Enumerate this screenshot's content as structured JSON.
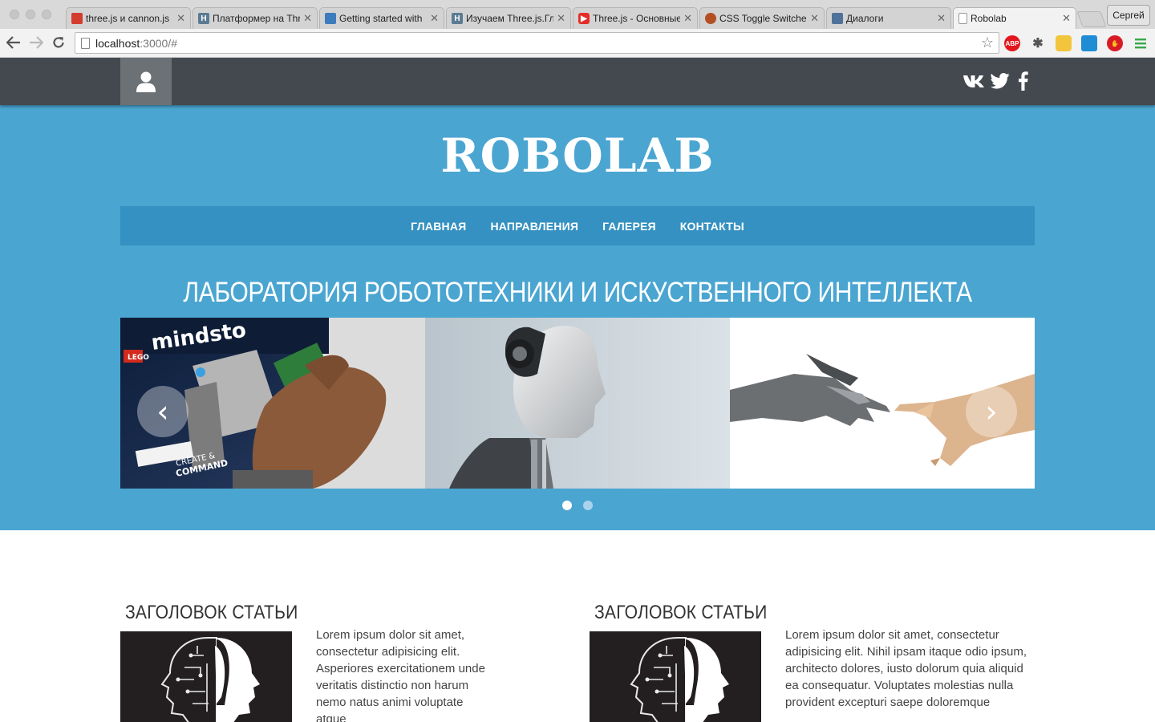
{
  "browser": {
    "tabs": [
      {
        "title": "three.js и cannon.js",
        "favicon_color": "#d43b2f"
      },
      {
        "title": "Платформер на Three",
        "favicon_color": "#5b7b93"
      },
      {
        "title": "Getting started with",
        "favicon_color": "#3e7bbd"
      },
      {
        "title": "Изучаем Three.js.Гл",
        "favicon_color": "#5b7b93"
      },
      {
        "title": "Three.js - Основные",
        "favicon_color": "#e52d27"
      },
      {
        "title": "CSS Toggle Switche",
        "favicon_color": "#b34f22"
      },
      {
        "title": "Диалоги",
        "favicon_color": "#507299"
      },
      {
        "title": "Robolab",
        "favicon_color": "#ffffff"
      }
    ],
    "active_tab": 7,
    "profile_name": "Сергей",
    "url_host": "localhost",
    "url_rest": ":3000/#",
    "extensions": [
      "ABP"
    ]
  },
  "site": {
    "logo": "ROBOLAB",
    "menu": [
      "ГЛАВНАЯ",
      "НАПРАВЛЕНИЯ",
      "ГАЛЕРЕЯ",
      "КОНТАКТЫ"
    ],
    "hero_title": "ЛАБОРАТОРИЯ РОБОТОТЕХНИКИ И ИСКУСТВЕННОГО ИНТЕЛЛЕКТА",
    "slider": {
      "current_slide": 1,
      "slide_count": 2
    },
    "social": [
      "vk-icon",
      "twitter-icon",
      "facebook-icon"
    ],
    "colors": {
      "topbar": "#43494e",
      "hero": "#4aa5d1",
      "menu": "#3591c1"
    },
    "articles": [
      {
        "title": "ЗАГОЛОВОК СТАТЬИ",
        "lines": [
          "Lorem ipsum dolor sit amet,",
          "consectetur adipisicing elit.",
          "Asperiores exercitationem unde",
          "veritatis distinctio non harum",
          "nemo natus animi voluptate",
          "atque"
        ]
      },
      {
        "title": "ЗАГОЛОВОК СТАТЬИ",
        "lines": [
          "Lorem ipsum dolor sit amet, consectetur",
          "adipisicing elit. Nihil ipsam itaque odio ipsum,",
          "architecto dolores, iusto dolorum quia aliquid",
          "ea consequatur. Voluptates molestias nulla",
          "provident excepturi saepe doloremque"
        ]
      }
    ]
  }
}
